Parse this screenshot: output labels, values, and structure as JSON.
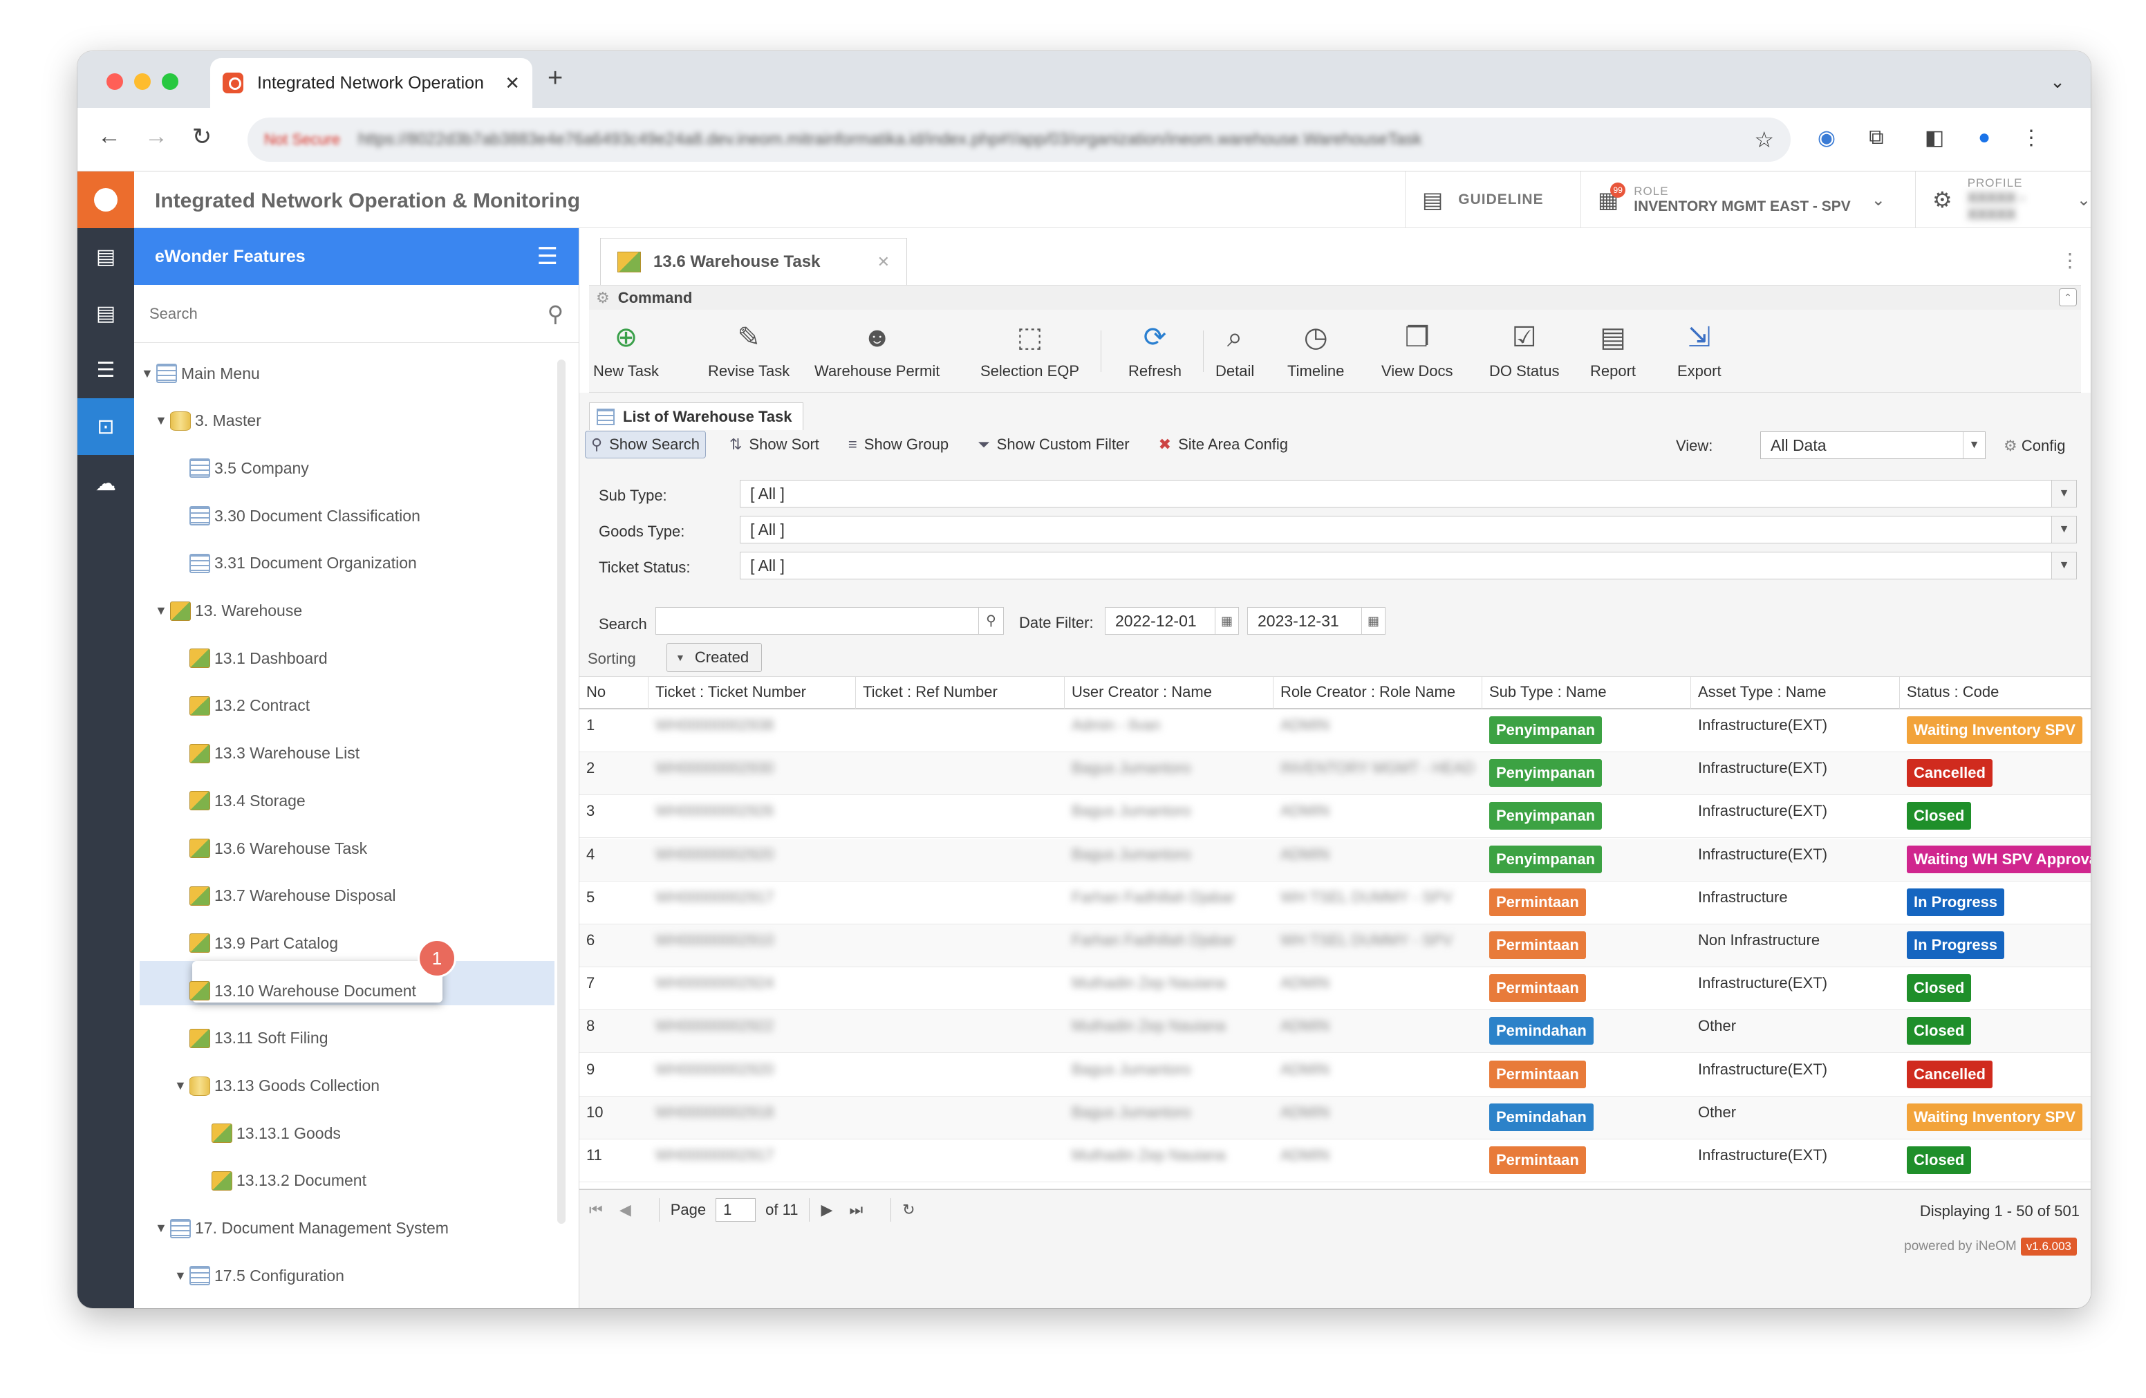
{
  "browser": {
    "tab_title": "Integrated Network Operation",
    "tab_close": "✕",
    "new_tab": "+",
    "tab_menu": "⌄",
    "address_security": "Not Secure",
    "address_url": "https://8022d3b7ab3883e4e76a6493c49e24a8.dev.ineom.mitrainformatika.id/index.php#!/app/03/organization/ineom.warehouse.WarehouseTask",
    "colors": {
      "close": "#ff5f57",
      "minimize": "#febc2e",
      "maximize": "#28c840"
    }
  },
  "header": {
    "app_title": "Integrated Network Operation & Monitoring",
    "guideline_label": "GUIDELINE",
    "role_badge": "99",
    "role_small": "ROLE",
    "role_value": "INVENTORY MGMT EAST - SPV",
    "profile_small": "PROFILE",
    "profile_value": "XXXXX - XXXXX"
  },
  "sidebar": {
    "title": "eWonder Features",
    "search_placeholder": "Search",
    "selected_badge": "1",
    "tree": [
      {
        "label": "Main Menu",
        "icon": "table",
        "expanded": true
      },
      {
        "label": "3. Master",
        "icon": "cyl",
        "expanded": true
      },
      {
        "label": "3.5 Company",
        "icon": "table"
      },
      {
        "label": "3.30 Document Classification",
        "icon": "table"
      },
      {
        "label": "3.31 Document Organization",
        "icon": "table"
      },
      {
        "label": "13. Warehouse",
        "icon": "box",
        "expanded": true
      },
      {
        "label": "13.1 Dashboard",
        "icon": "box"
      },
      {
        "label": "13.2 Contract",
        "icon": "box"
      },
      {
        "label": "13.3 Warehouse List",
        "icon": "box"
      },
      {
        "label": "13.4 Storage",
        "icon": "box"
      },
      {
        "label": "13.6 Warehouse Task",
        "icon": "box",
        "selected": true
      },
      {
        "label": "13.7 Warehouse Disposal",
        "icon": "box"
      },
      {
        "label": "13.9 Part Catalog",
        "icon": "box"
      },
      {
        "label": "13.10 Warehouse Document",
        "icon": "box"
      },
      {
        "label": "13.11 Soft Filing",
        "icon": "box"
      },
      {
        "label": "13.13 Goods Collection",
        "icon": "cyl",
        "expanded": true
      },
      {
        "label": "13.13.1 Goods",
        "icon": "box"
      },
      {
        "label": "13.13.2 Document",
        "icon": "box"
      },
      {
        "label": "17. Document Management System",
        "icon": "table",
        "expanded": true
      },
      {
        "label": "17.5 Configuration",
        "icon": "table",
        "expanded": true
      }
    ]
  },
  "main": {
    "tab_title": "13.6 Warehouse Task",
    "command_title": "Command",
    "commands": [
      {
        "label": "New Task",
        "icon": "plus-circle-icon"
      },
      {
        "label": "Revise Task",
        "icon": "pencil-icon"
      },
      {
        "label": "Warehouse Permit",
        "icon": "worker-icon"
      },
      {
        "label": "Selection EQP",
        "icon": "selection-icon"
      },
      {
        "label": "Refresh",
        "icon": "refresh-icon"
      },
      {
        "label": "Detail",
        "icon": "magnifier-doc-icon"
      },
      {
        "label": "Timeline",
        "icon": "clock-icon"
      },
      {
        "label": "View Docs",
        "icon": "docs-icon"
      },
      {
        "label": "DO Status",
        "icon": "checklist-icon"
      },
      {
        "label": "Report",
        "icon": "report-icon"
      },
      {
        "label": "Export",
        "icon": "export-icon"
      }
    ],
    "list_title": "List of Warehouse Task",
    "list_tools": [
      "Show Search",
      "Show Sort",
      "Show Group",
      "Show Custom Filter",
      "Site Area Config"
    ],
    "view_label": "View:",
    "view_value": "All Data",
    "config_label": "Config",
    "filters": [
      {
        "label": "Sub Type:",
        "value": "[ All ]"
      },
      {
        "label": "Goods Type:",
        "value": "[ All ]"
      },
      {
        "label": "Ticket Status:",
        "value": "[ All ]"
      }
    ],
    "search_label": "Search",
    "search_value": "",
    "date_filter_label": "Date Filter:",
    "date_from": "2022-12-01",
    "date_to": "2023-12-31",
    "sorting_label": "Sorting",
    "sorting_value": "Created",
    "columns": [
      "No",
      "Ticket : Ticket Number",
      "Ticket : Ref Number",
      "User Creator : Name",
      "Role Creator : Role Name",
      "Sub Type : Name",
      "Asset Type : Name",
      "Status : Code"
    ],
    "rows": [
      {
        "no": "1",
        "ticket": "WH00000002938",
        "ref": "",
        "user": "Admin - Ilvan",
        "role": "ADMIN",
        "subtype": "Penyimpanan",
        "subtype_color": "green",
        "asset": "Infrastructure(EXT)",
        "status": "Waiting Inventory SPV",
        "status_color": "yellow"
      },
      {
        "no": "2",
        "ticket": "WH00000002930",
        "ref": "",
        "user": "Bagus Jumantoro",
        "role": "INVENTORY MGMT - HEAD",
        "subtype": "Penyimpanan",
        "subtype_color": "green",
        "asset": "Infrastructure(EXT)",
        "status": "Cancelled",
        "status_color": "red"
      },
      {
        "no": "3",
        "ticket": "WH00000002926",
        "ref": "",
        "user": "Bagus Jumantoro",
        "role": "ADMIN",
        "subtype": "Penyimpanan",
        "subtype_color": "green",
        "asset": "Infrastructure(EXT)",
        "status": "Closed",
        "status_color": "dgreen"
      },
      {
        "no": "4",
        "ticket": "WH00000002920",
        "ref": "",
        "user": "Bagus Jumantoro",
        "role": "ADMIN",
        "subtype": "Penyimpanan",
        "subtype_color": "green",
        "asset": "Infrastructure(EXT)",
        "status": "Waiting WH SPV Approval",
        "status_color": "magenta"
      },
      {
        "no": "5",
        "ticket": "WH00000002917",
        "ref": "",
        "user": "Farhan Fadhillah Djabar",
        "role": "WH TSEL DUMMY - SPV",
        "subtype": "Permintaan",
        "subtype_color": "orange",
        "asset": "Infrastructure",
        "status": "In Progress",
        "status_color": "navy"
      },
      {
        "no": "6",
        "ticket": "WH00000002910",
        "ref": "",
        "user": "Farhan Fadhillah Djabar",
        "role": "WH TSEL DUMMY - SPV",
        "subtype": "Permintaan",
        "subtype_color": "orange",
        "asset": "Non Infrastructure",
        "status": "In Progress",
        "status_color": "navy"
      },
      {
        "no": "7",
        "ticket": "WH00000002924",
        "ref": "",
        "user": "Muthadin Zep Nauiana",
        "role": "ADMIN",
        "subtype": "Permintaan",
        "subtype_color": "orange",
        "asset": "Infrastructure(EXT)",
        "status": "Closed",
        "status_color": "dgreen"
      },
      {
        "no": "8",
        "ticket": "WH00000002922",
        "ref": "",
        "user": "Muthadin Zep Nauiana",
        "role": "ADMIN",
        "subtype": "Pemindahan",
        "subtype_color": "blue",
        "asset": "Other",
        "status": "Closed",
        "status_color": "dgreen"
      },
      {
        "no": "9",
        "ticket": "WH00000002920",
        "ref": "",
        "user": "Bagus Jumantoro",
        "role": "ADMIN",
        "subtype": "Permintaan",
        "subtype_color": "orange",
        "asset": "Infrastructure(EXT)",
        "status": "Cancelled",
        "status_color": "red"
      },
      {
        "no": "10",
        "ticket": "WH00000002918",
        "ref": "",
        "user": "Bagus Jumantoro",
        "role": "ADMIN",
        "subtype": "Pemindahan",
        "subtype_color": "blue",
        "asset": "Other",
        "status": "Waiting Inventory SPV",
        "status_color": "yellow"
      },
      {
        "no": "11",
        "ticket": "WH00000002917",
        "ref": "",
        "user": "Muthadin Zep Nauiana",
        "role": "ADMIN",
        "subtype": "Permintaan",
        "subtype_color": "orange",
        "asset": "Infrastructure(EXT)",
        "status": "Closed",
        "status_color": "dgreen"
      }
    ],
    "pager": {
      "page_label": "Page",
      "page_value": "1",
      "of_label": "of 11",
      "display": "Displaying 1 - 50 of 501"
    },
    "powered_by": "powered by iNeOM",
    "version": "v1.6.003"
  }
}
